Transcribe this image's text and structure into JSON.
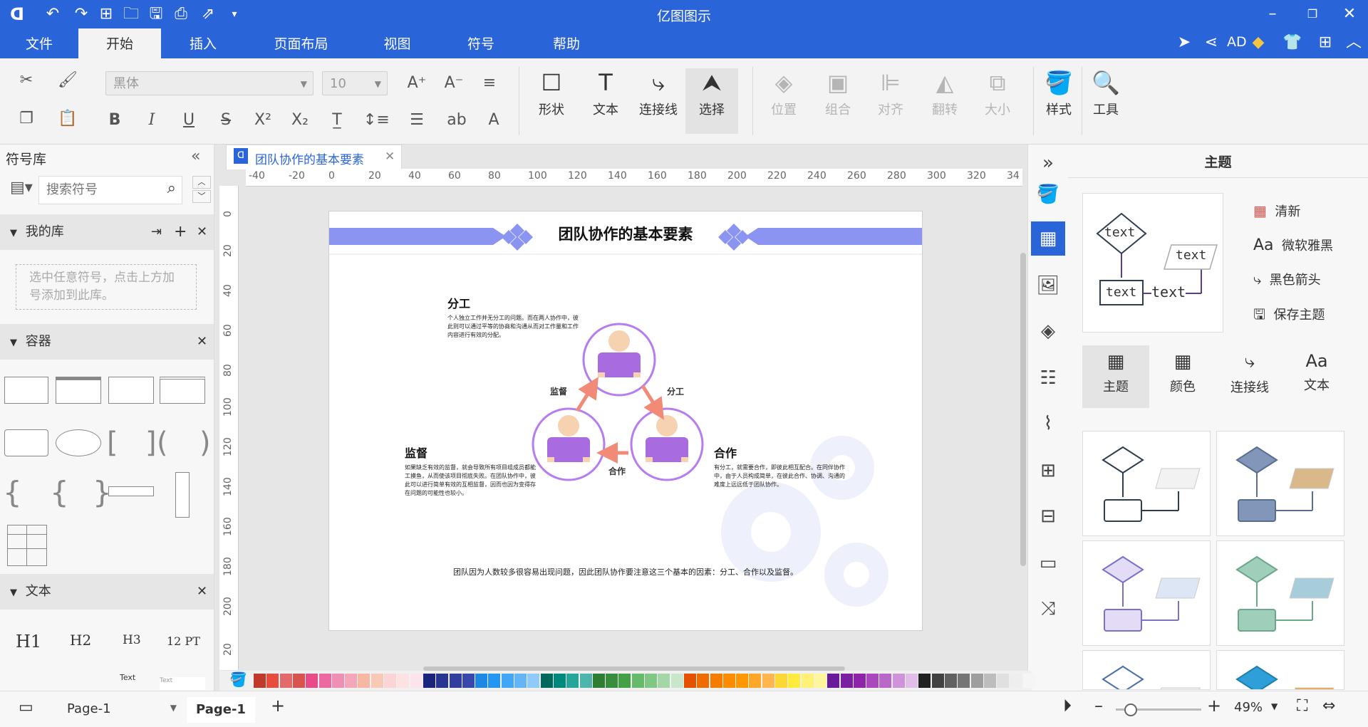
{
  "app": {
    "title": "亿图图示",
    "accent": "#2a64d9"
  },
  "menu": {
    "file": "文件",
    "tabs": [
      "开始",
      "插入",
      "页面布局",
      "视图",
      "符号",
      "帮助"
    ],
    "active_tab": "开始",
    "user": "AD"
  },
  "ribbon": {
    "font_family": "黑体",
    "font_size": "10",
    "big_buttons": [
      {
        "label": "形状",
        "icon": "square-icon"
      },
      {
        "label": "文本",
        "icon": "text-icon"
      },
      {
        "label": "连接线",
        "icon": "connector-icon"
      },
      {
        "label": "选择",
        "icon": "cursor-icon"
      }
    ],
    "disabled_buttons": [
      {
        "label": "位置",
        "icon": "layers-icon"
      },
      {
        "label": "组合",
        "icon": "group-icon"
      },
      {
        "label": "对齐",
        "icon": "align-icon"
      },
      {
        "label": "翻转",
        "icon": "flip-icon"
      },
      {
        "label": "大小",
        "icon": "size-icon"
      }
    ],
    "style_label": "样式",
    "tools_label": "工具"
  },
  "left_panel": {
    "title": "符号库",
    "search_placeholder": "搜索符号",
    "my_library": "我的库",
    "my_library_hint": "选中任意符号，点击上方加号添加到此库。",
    "container": "容器",
    "text_section": "文本",
    "text_samples": [
      "H1",
      "H2",
      "H3",
      "12 PT"
    ],
    "text_small": [
      "Text",
      "Text"
    ]
  },
  "document": {
    "tab_title": "团队协作的基本要素",
    "hruler": [
      "-40",
      "-20",
      "0",
      "20",
      "40",
      "60",
      "80",
      "100",
      "120",
      "140",
      "160",
      "180",
      "200",
      "220",
      "240",
      "260",
      "280",
      "300",
      "320",
      "34"
    ],
    "vruler": [
      "0",
      "20",
      "40",
      "60",
      "80",
      "100",
      "120",
      "140",
      "160",
      "180",
      "200",
      "20"
    ]
  },
  "diagram": {
    "title": "团队协作的基本要素",
    "top_heading": "分工",
    "top_text": "个人独立工作并无分工的问题。而在两人协作中，彼此则可以通过平等的协商和沟通从而对工作量和工作内容进行有效的分配。",
    "left_heading": "监督",
    "left_text": "如果缺乏有效的监督，就会导致所有项目组成员都能工摸鱼，从而使该项目彻底失败。在团队协作中，彼此可以进行简单有效的互相监督，因而也因为变得存在问题的可能性也较小。",
    "right_heading": "合作",
    "right_text": "有分工，就需要合作，即彼此相互配合。在同伴协作中，由于人员构成简单，在彼此合作、协调、沟通的难度上远远低于团队协作。",
    "label_fengong": "分工",
    "label_jiandu": "监督",
    "label_hezuo": "合作",
    "footer": "团队因为人数较多很容易出现问题，因此团队协作要注意这三个基本的因素：分工、合作以及监督。",
    "colors": {
      "banner": "#8c94f2",
      "circle": "#b57df0",
      "arrow": "#f28a78",
      "person": "#a86be0",
      "face": "#f7d2b0"
    }
  },
  "right_panel": {
    "title": "主题",
    "preview_texts": [
      "text",
      "text",
      "text",
      "text"
    ],
    "options": [
      "清新",
      "微软雅黑",
      "黑色箭头",
      "保存主题"
    ],
    "tabs": [
      "主题",
      "颜色",
      "连接线",
      "文本"
    ],
    "theme_colors": [
      {
        "fill": "#ffffff",
        "stroke": "#2c3e50",
        "accent": "#f2f2f2"
      },
      {
        "fill": "#8196b8",
        "stroke": "#5a6f8f",
        "accent": "#d9b98a"
      },
      {
        "fill": "#e4dcf7",
        "stroke": "#7a72c7",
        "accent": "#dde6f5"
      },
      {
        "fill": "#9fcfbb",
        "stroke": "#6aa889",
        "accent": "#a6cdd9"
      },
      {
        "fill": "#ffffff",
        "stroke": "#4a6fa5",
        "accent": "#f2f2f2"
      },
      {
        "fill": "#2e9fd9",
        "stroke": "#1f7fb0",
        "accent": "#f0a23a"
      }
    ]
  },
  "status": {
    "page_selector": "Page-1",
    "page_tab": "Page-1",
    "zoom": "49%"
  },
  "palette": [
    "#c0392b",
    "#e74c3c",
    "#e26a6a",
    "#d9534f",
    "#e84a8a",
    "#ec6aa0",
    "#f08fb4",
    "#f4a7b9",
    "#f7b7a3",
    "#f9c9b6",
    "#fbd5d5",
    "#fde2e2",
    "#fce4ec",
    "#1a237e",
    "#283593",
    "#303f9f",
    "#3949ab",
    "#1e88e5",
    "#2196f3",
    "#42a5f5",
    "#64b5f6",
    "#90caf9",
    "#00695c",
    "#00897b",
    "#26a69a",
    "#4db6ac",
    "#2e7d32",
    "#388e3c",
    "#43a047",
    "#66bb6a",
    "#81c784",
    "#a5d6a7",
    "#c8e6c9",
    "#e65100",
    "#ef6c00",
    "#f57c00",
    "#fb8c00",
    "#ff9800",
    "#ffa726",
    "#ffb74d",
    "#fdd835",
    "#ffeb3b",
    "#fff176",
    "#fff59d",
    "#6a1b9a",
    "#7b1fa2",
    "#8e24aa",
    "#ab47bc",
    "#ba68c8",
    "#ce93d8",
    "#e1bee7",
    "#212121",
    "#424242",
    "#616161",
    "#757575",
    "#9e9e9e",
    "#bdbdbd",
    "#e0e0e0",
    "#eeeeee",
    "#f5f5f5"
  ]
}
